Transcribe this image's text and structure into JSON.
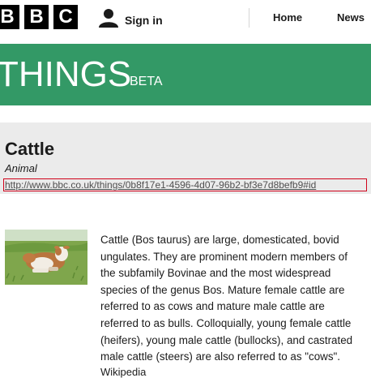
{
  "topnav": {
    "logo_letters": [
      "B",
      "B",
      "C"
    ],
    "signin_label": "Sign in",
    "links": [
      "Home",
      "News"
    ]
  },
  "banner": {
    "title": "THINGS",
    "tag": "BETA",
    "color": "#339966"
  },
  "entity": {
    "title": "Cattle",
    "type": "Animal",
    "uri": "http://www.bbc.co.uk/things/0b8f17e1-4596-4d07-96b2-bf3e7d8befb9#id"
  },
  "article": {
    "description": "Cattle (Bos taurus) are large, domesticated, bovid ungulates. They are prominent modern members of the subfamily Bovinae and the most widespread species of the genus Bos. Mature female cattle are referred to as cows and mature male cattle are referred to as bulls. Colloquially, young female cattle (heifers), young male cattle (bullocks), and castrated male cattle (steers) are also referred to as \"cows\".",
    "source": "Wikipedia"
  },
  "icons": {
    "signin": "user-icon",
    "thumbnail": "cow-photo"
  }
}
